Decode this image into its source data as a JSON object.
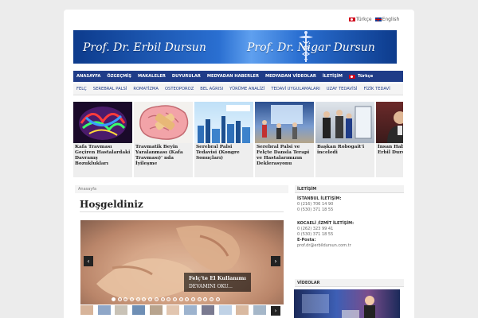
{
  "languages": [
    "Türkçe",
    "English"
  ],
  "banner": {
    "name_left": "Prof. Dr. Erbil Dursun",
    "name_right": "Prof. Dr. Nigar Dursun"
  },
  "nav": {
    "items": [
      "ANASAYFA",
      "ÖZGEÇMİŞ",
      "MAKALELER",
      "DUYURULAR",
      "MEDYADAN HABERLER",
      "MEDYADAN VİDEOLAR",
      "İLETİŞİM",
      "Türkçe"
    ]
  },
  "subnav": {
    "items": [
      "FELÇ",
      "SEREBRAL PALSİ",
      "ROMATİZMA",
      "OSTEOPOROZ",
      "BEL AĞRISI",
      "YÜRÜME ANALİZİ",
      "TEDAVİ UYGULAMALARI",
      "UZAY TEDAVİSİ",
      "FİZİK TEDAVİ"
    ]
  },
  "featured": [
    {
      "caption": "Kafa Travması Geçiren Hastalardaki Davranış Bozuklukları",
      "image": "brain-fiber-image"
    },
    {
      "caption": "Travmatik Beyin Yaralanması (Kafa Travması)' nda İyileşme",
      "image": "bandaged-brain-image"
    },
    {
      "caption": "Serebral Palsi Tedavisi (Kongre Sonuçları)",
      "image": "congress-city-image"
    },
    {
      "caption": "Serebral Palsi ve Felçte Dansla Terapi ve Hastalarımızın Deklerasyonu",
      "image": "dance-therapy-image"
    },
    {
      "caption": "Başkan Robogait'i inceledi",
      "image": "robogait-image"
    },
    {
      "caption": "İnsan Haber'de Dr. Erbil Dursun Söyleşi",
      "image": "interview-image"
    }
  ],
  "breadcrumb": "Anasayfa",
  "page_title": "Hoşgeldiniz",
  "slider": {
    "caption_title": "Felç'te El Kullanımı",
    "caption_more": "DEVAMINI OKU...",
    "dot_count": 18,
    "active_dot": 0,
    "prev_icon": "chevron-left-icon",
    "next_icon": "chevron-right-icon"
  },
  "sidebar": {
    "contact": {
      "heading": "İLETİŞİM",
      "istanbul_label": "İSTANBUL İLETİŞİM:",
      "istanbul_phones": [
        "0 (216) 706 14 90",
        "0 (530) 371 18 55"
      ],
      "kocaeli_label": "KOCAELİ /İZMİT İLETİŞİM:",
      "kocaeli_phones": [
        "0 (262) 323 99 41",
        "0 (530) 371 18 55"
      ],
      "email_label": "E-Posta:",
      "email": "prof.dr@erbildursun.com.tr"
    },
    "videos": {
      "heading": "VİDEOLAR"
    }
  },
  "colors": {
    "nav_bg": "#1f3c88",
    "banner_blue": "#2a6fd1",
    "thumb_bg": "#eeeeee"
  }
}
